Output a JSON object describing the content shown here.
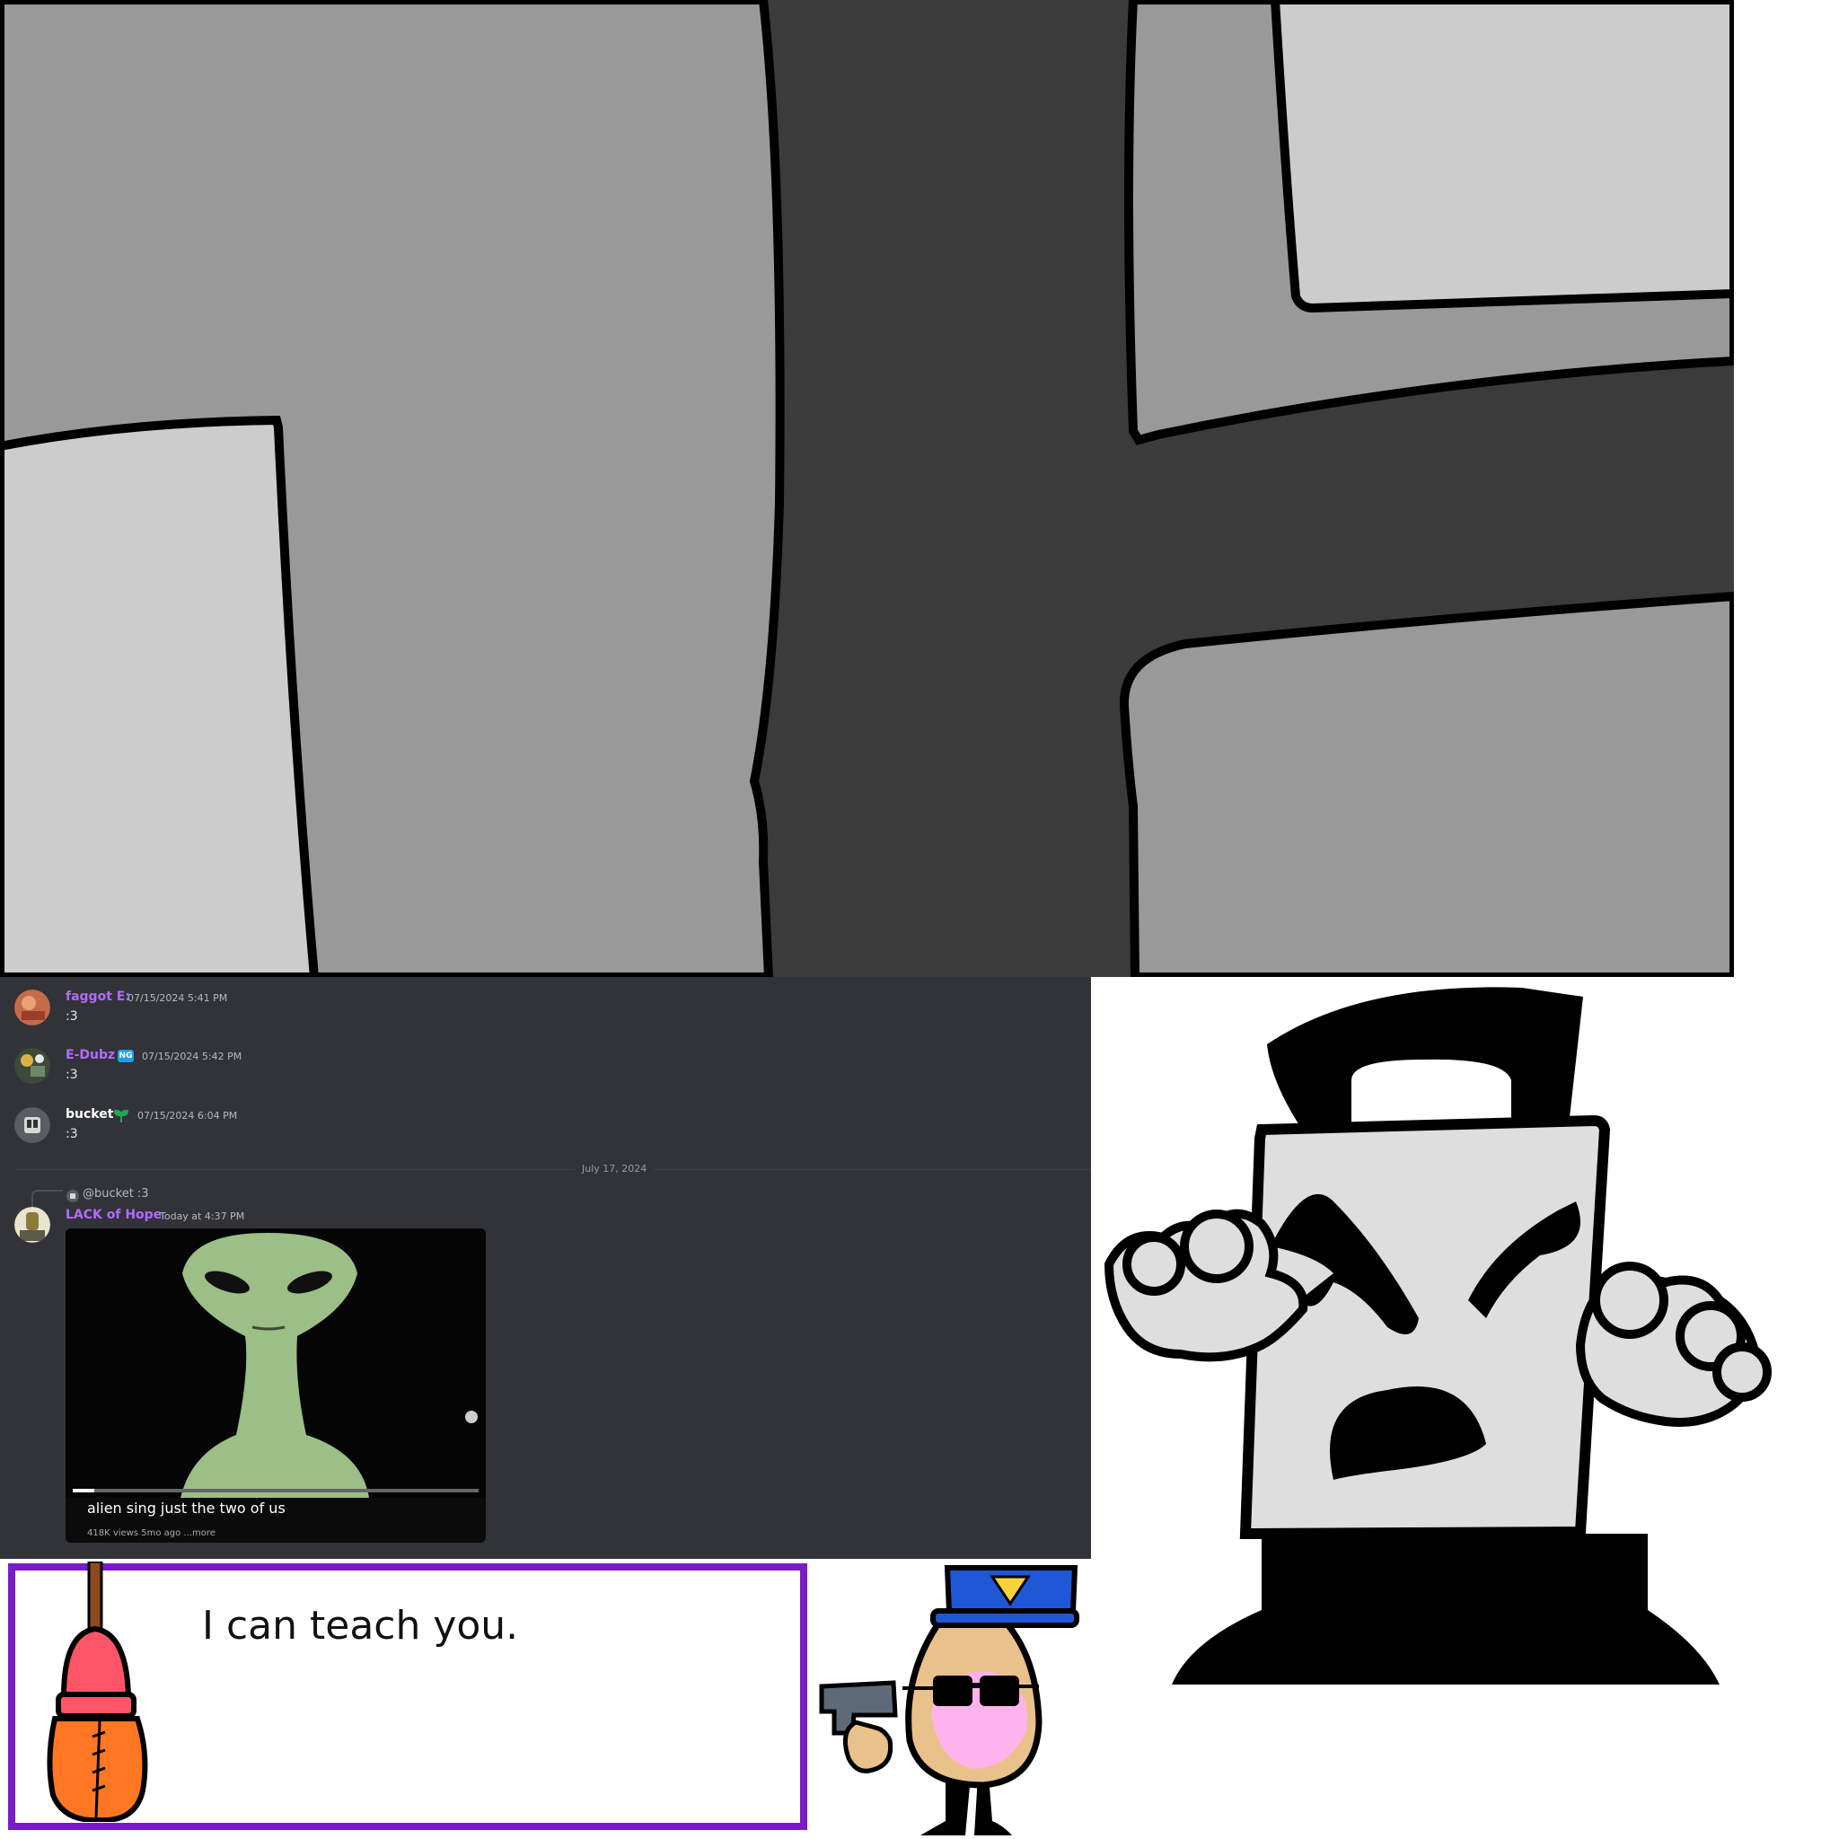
{
  "chat": {
    "messages": [
      {
        "name": "faggot E:",
        "time": "07/15/2024 5:41 PM",
        "text": ":3"
      },
      {
        "name": "E-Dubz",
        "badge": "NG",
        "time": "07/15/2024 5:42 PM",
        "text": ":3"
      },
      {
        "name": "bucket",
        "time": "07/15/2024 6:04 PM",
        "text": ":3"
      }
    ],
    "date_divider": "July 17, 2024",
    "reply": {
      "preview": "@bucket :3",
      "name": "LACK of Hope",
      "time": "Today at 4:37 PM"
    },
    "embed": {
      "title": "alien sing just the two of us",
      "meta": "418K views  5mo ago  ...more"
    }
  },
  "dialog": {
    "text": "I can teach you."
  },
  "colors": {
    "chat_bg": "#313338",
    "username_purple": "#b26bff",
    "dialog_border": "#7a1bc9"
  }
}
